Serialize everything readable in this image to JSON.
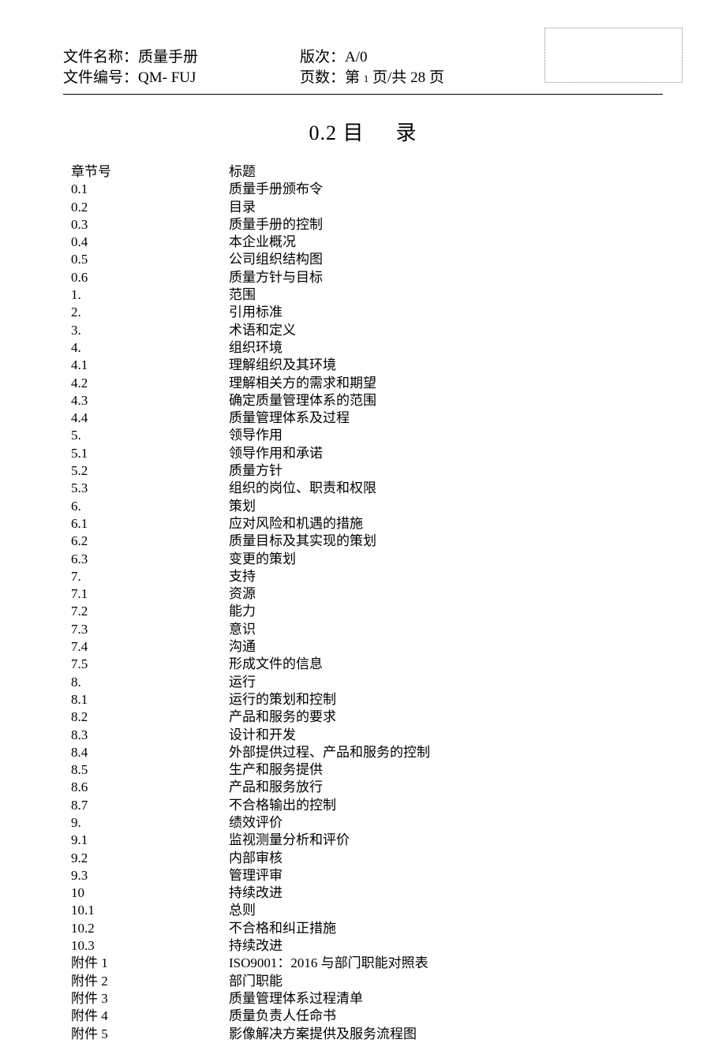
{
  "header": {
    "fileNameLabel": "文件名称：",
    "fileNameValue": "质量手册",
    "versionLabel": "版次：",
    "versionValue": "A/0",
    "fileNoLabel": "文件编号：",
    "fileNoValue": "QM- FUJ",
    "pageLabel": "页数：",
    "pagePrefix": "第 ",
    "pageCurrent": "1",
    "pageMid": " 页/共 ",
    "pageTotal": "28",
    "pageSuffix": " 页"
  },
  "pageTitle": {
    "prefix": "0.2 目",
    "suffix": "录"
  },
  "tocHeader": {
    "col1": "章节号",
    "col2": "标题"
  },
  "toc": [
    {
      "num": "0.1",
      "title": "质量手册颁布令"
    },
    {
      "num": "0.2",
      "title": "目录"
    },
    {
      "num": "0.3",
      "title": "质量手册的控制"
    },
    {
      "num": "0.4",
      "title": "本企业概况"
    },
    {
      "num": "0.5",
      "title": "公司组织结构图"
    },
    {
      "num": "0.6",
      "title": "质量方针与目标"
    },
    {
      "num": "1.",
      "title": "范围"
    },
    {
      "num": "2.",
      "title": "引用标准"
    },
    {
      "num": "3.",
      "title": "术语和定义"
    },
    {
      "num": "4.",
      "title": "组织环境"
    },
    {
      "num": "4.1",
      "title": "理解组织及其环境"
    },
    {
      "num": "4.2",
      "title": "理解相关方的需求和期望"
    },
    {
      "num": "4.3",
      "title": "确定质量管理体系的范围"
    },
    {
      "num": "4.4",
      "title": "质量管理体系及过程"
    },
    {
      "num": "5.",
      "title": "领导作用"
    },
    {
      "num": "5.1",
      "title": "领导作用和承诺"
    },
    {
      "num": "5.2",
      "title": "质量方针"
    },
    {
      "num": "5.3",
      "title": "组织的岗位、职责和权限"
    },
    {
      "num": "6.",
      "title": "策划"
    },
    {
      "num": "6.1",
      "title": "应对风险和机遇的措施"
    },
    {
      "num": "6.2",
      "title": "质量目标及其实现的策划"
    },
    {
      "num": "6.3",
      "title": "变更的策划"
    },
    {
      "num": "7.",
      "title": "支持"
    },
    {
      "num": "7.1",
      "title": "资源"
    },
    {
      "num": "7.2",
      "title": "能力"
    },
    {
      "num": "7.3",
      "title": "意识"
    },
    {
      "num": "7.4",
      "title": "沟通"
    },
    {
      "num": "7.5",
      "title": "形成文件的信息"
    },
    {
      "num": "8.",
      "title": "运行"
    },
    {
      "num": "8.1",
      "title": "运行的策划和控制"
    },
    {
      "num": "8.2",
      "title": "产品和服务的要求"
    },
    {
      "num": "8.3",
      "title": "设计和开发"
    },
    {
      "num": "8.4",
      "title": "外部提供过程、产品和服务的控制"
    },
    {
      "num": "8.5",
      "title": "生产和服务提供"
    },
    {
      "num": "8.6",
      "title": "产品和服务放行"
    },
    {
      "num": "8.7",
      "title": "不合格输出的控制"
    },
    {
      "num": "9.",
      "title": "绩效评价"
    },
    {
      "num": "9.1",
      "title": "监视测量分析和评价"
    },
    {
      "num": "9.2",
      "title": "内部审核"
    },
    {
      "num": "9.3",
      "title": "管理评审"
    },
    {
      "num": "10",
      "title": "持续改进"
    },
    {
      "num": "10.1",
      "title": "总则"
    },
    {
      "num": "10.2",
      "title": "不合格和纠正措施"
    },
    {
      "num": "10.3",
      "title": "持续改进"
    },
    {
      "num": "附件 1",
      "title": "ISO9001：2016 与部门职能对照表"
    },
    {
      "num": "附件 2",
      "title": "部门职能"
    },
    {
      "num": "附件 3",
      "title": "质量管理体系过程清单"
    },
    {
      "num": "附件 4",
      "title": "质量负责人任命书"
    },
    {
      "num": "附件 5",
      "title": "影像解决方案提供及服务流程图"
    }
  ]
}
